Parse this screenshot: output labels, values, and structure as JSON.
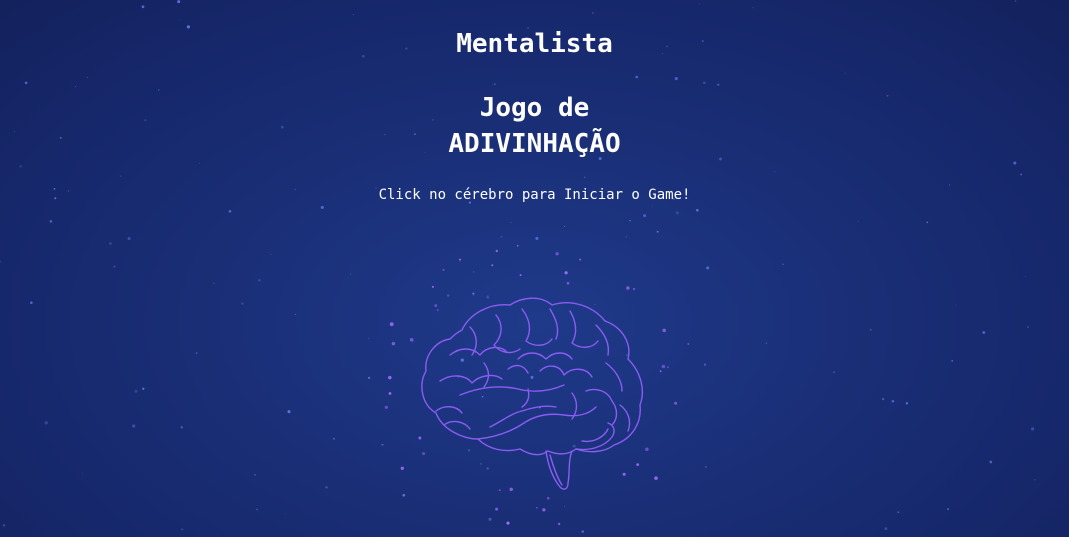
{
  "app_title": "Mentalista",
  "game": {
    "title_line1": "Jogo de",
    "title_line2": "ADIVINHAÇÃO",
    "instruction": "Click no cérebro para Iniciar o Game!"
  },
  "start_button": {
    "icon": "brain-icon"
  },
  "colors": {
    "background_top": "#1a2f78",
    "background_mid": "#1f3a8a",
    "text": "#ffffff",
    "brain_stroke": "#8a5cf0",
    "particle": "#a56bff"
  }
}
